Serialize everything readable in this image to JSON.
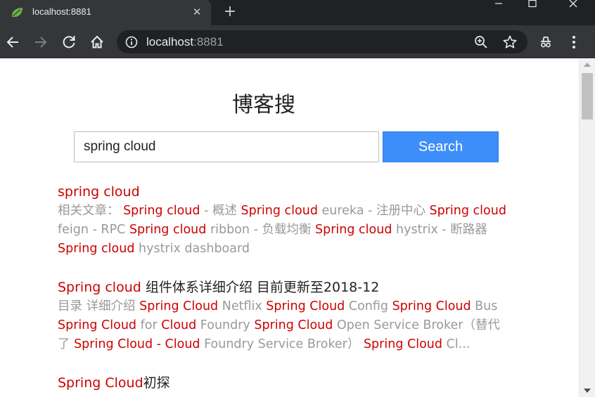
{
  "browser": {
    "tab_title": "localhost:8881",
    "url_host": "localhost",
    "url_port": ":8881"
  },
  "page": {
    "title": "博客搜",
    "search_value": "spring cloud",
    "search_button": "Search"
  },
  "results": [
    {
      "title": [
        {
          "text": "spring cloud",
          "hl": true
        }
      ],
      "snippet": [
        {
          "text": "相关文章： ",
          "hl": false
        },
        {
          "text": "Spring cloud",
          "hl": true
        },
        {
          "text": " - 概述 ",
          "hl": false
        },
        {
          "text": "Spring cloud",
          "hl": true
        },
        {
          "text": " eureka - 注册中心 ",
          "hl": false
        },
        {
          "text": "Spring cloud",
          "hl": true
        },
        {
          "text": " feign - RPC ",
          "hl": false
        },
        {
          "text": "Spring cloud",
          "hl": true
        },
        {
          "text": " ribbon - 负载均衡 ",
          "hl": false
        },
        {
          "text": "Spring cloud",
          "hl": true
        },
        {
          "text": " hystrix - 断路器 ",
          "hl": false
        },
        {
          "text": "Spring cloud",
          "hl": true
        },
        {
          "text": " hystrix dashboard",
          "hl": false
        }
      ]
    },
    {
      "title": [
        {
          "text": "Spring cloud",
          "hl": true
        },
        {
          "text": " 组件体系详细介绍 目前更新至2018-12",
          "hl": false
        }
      ],
      "snippet": [
        {
          "text": "目录 详细介绍 ",
          "hl": false
        },
        {
          "text": "Spring Cloud",
          "hl": true
        },
        {
          "text": " Netflix ",
          "hl": false
        },
        {
          "text": "Spring Cloud",
          "hl": true
        },
        {
          "text": " Config ",
          "hl": false
        },
        {
          "text": "Spring Cloud",
          "hl": true
        },
        {
          "text": " Bus ",
          "hl": false
        },
        {
          "text": "Spring Cloud",
          "hl": true
        },
        {
          "text": " for ",
          "hl": false
        },
        {
          "text": "Cloud",
          "hl": true
        },
        {
          "text": " Foundry ",
          "hl": false
        },
        {
          "text": "Spring Cloud",
          "hl": true
        },
        {
          "text": " Open Service Broker（替代了 ",
          "hl": false
        },
        {
          "text": "Spring Cloud - Cloud",
          "hl": true
        },
        {
          "text": " Foundry Service Broker） ",
          "hl": false
        },
        {
          "text": "Spring Cloud",
          "hl": true
        },
        {
          "text": " Cl...",
          "hl": false
        }
      ]
    },
    {
      "title": [
        {
          "text": "Spring Cloud",
          "hl": true
        },
        {
          "text": "初探",
          "hl": false
        }
      ],
      "snippet": []
    }
  ],
  "colors": {
    "highlight": "#cc0000",
    "snippet": "#999999",
    "button": "#3d8ef8"
  }
}
